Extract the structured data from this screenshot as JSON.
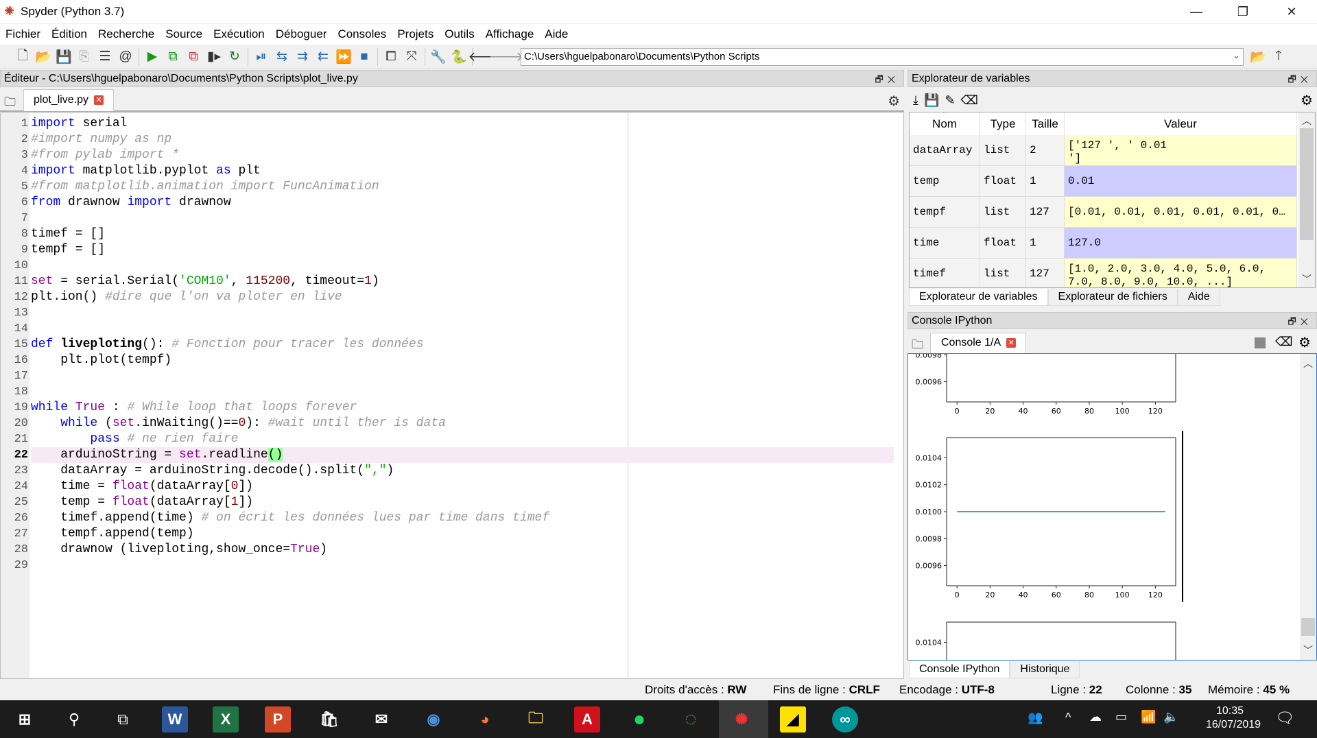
{
  "window": {
    "title": "Spyder (Python 3.7)",
    "controls": [
      "minimize-icon",
      "restore-icon",
      "close-icon"
    ]
  },
  "menu": [
    "Fichier",
    "Édition",
    "Recherche",
    "Source",
    "Exécution",
    "Déboguer",
    "Consoles",
    "Projets",
    "Outils",
    "Affichage",
    "Aide"
  ],
  "toolbar": {
    "path": "C:\\Users\\hguelpabonaro\\Documents\\Python Scripts"
  },
  "editor": {
    "title": "Éditeur - C:\\Users\\hguelpabonaro\\Documents\\Python Scripts\\plot_live.py",
    "tab": "plot_live.py",
    "current_line": 22,
    "lines": [
      [
        [
          "kw",
          "import"
        ],
        [
          "",
          " serial"
        ]
      ],
      [
        [
          "cm",
          "#import numpy as np"
        ]
      ],
      [
        [
          "cm",
          "#from pylab import *"
        ]
      ],
      [
        [
          "kw",
          "import"
        ],
        [
          "",
          " matplotlib.pyplot "
        ],
        [
          "kw",
          "as"
        ],
        [
          "",
          " plt"
        ]
      ],
      [
        [
          "cm",
          "#from matplotlib.animation import FuncAnimation"
        ]
      ],
      [
        [
          "kw",
          "from"
        ],
        [
          "",
          " drawnow "
        ],
        [
          "kw",
          "import"
        ],
        [
          "",
          " drawnow"
        ]
      ],
      [],
      [
        [
          "",
          "timef = []"
        ]
      ],
      [
        [
          "",
          "tempf = []"
        ]
      ],
      [],
      [
        [
          "bi",
          "set"
        ],
        [
          "",
          " = serial.Serial("
        ],
        [
          "st",
          "'COM10'"
        ],
        [
          "",
          ", "
        ],
        [
          "nm",
          "115200"
        ],
        [
          "",
          ", timeout="
        ],
        [
          "nm",
          "1"
        ],
        [
          "",
          ")"
        ]
      ],
      [
        [
          "",
          "plt.ion() "
        ],
        [
          "cm",
          "#dire que l'on va ploter en live"
        ]
      ],
      [],
      [],
      [
        [
          "kw",
          "def"
        ],
        [
          "",
          " "
        ],
        [
          "fn",
          "liveploting"
        ],
        [
          "",
          "(): "
        ],
        [
          "cm",
          "# Fonction pour tracer les données"
        ]
      ],
      [
        [
          "",
          "    plt.plot(tempf)"
        ]
      ],
      [],
      [],
      [
        [
          "kw",
          "while"
        ],
        [
          "",
          " "
        ],
        [
          "bi",
          "True"
        ],
        [
          "",
          " : "
        ],
        [
          "cm",
          "# While loop that loops forever"
        ]
      ],
      [
        [
          "",
          "    "
        ],
        [
          "kw",
          "while"
        ],
        [
          "",
          " ("
        ],
        [
          "bi",
          "set"
        ],
        [
          "",
          ".inWaiting()=="
        ],
        [
          "nm",
          "0"
        ],
        [
          "",
          "): "
        ],
        [
          "cm",
          "#wait until ther is data"
        ]
      ],
      [
        [
          "",
          "        "
        ],
        [
          "kw",
          "pass"
        ],
        [
          "",
          " "
        ],
        [
          "cm",
          "# ne rien faire"
        ]
      ],
      [
        [
          "",
          "    arduinoString = "
        ],
        [
          "bi",
          "set"
        ],
        [
          "",
          ".readline"
        ],
        [
          "mt",
          "()"
        ]
      ],
      [
        [
          "",
          "    dataArray = arduinoString.decode().split("
        ],
        [
          "st",
          "\",\""
        ],
        [
          "",
          ")"
        ]
      ],
      [
        [
          "",
          "    time = "
        ],
        [
          "bi",
          "float"
        ],
        [
          "",
          "(dataArray["
        ],
        [
          "nm",
          "0"
        ],
        [
          "",
          "])"
        ]
      ],
      [
        [
          "",
          "    temp = "
        ],
        [
          "bi",
          "float"
        ],
        [
          "",
          "(dataArray["
        ],
        [
          "nm",
          "1"
        ],
        [
          "",
          "])"
        ]
      ],
      [
        [
          "",
          "    timef.append(time) "
        ],
        [
          "cm",
          "# on écrit les données lues par time dans timef"
        ]
      ],
      [
        [
          "",
          "    tempf.append(temp)"
        ]
      ],
      [
        [
          "",
          "    drawnow (liveploting,show_once="
        ],
        [
          "bi",
          "True"
        ],
        [
          "",
          ")"
        ]
      ],
      []
    ]
  },
  "variable_explorer": {
    "title": "Explorateur de variables",
    "columns": [
      "Nom",
      "Type",
      "Taille",
      "Valeur"
    ],
    "rows": [
      {
        "name": "dataArray",
        "type": "list",
        "size": "2",
        "value": "['127 ', ' 0.01\n']",
        "color": "#ffffcc"
      },
      {
        "name": "temp",
        "type": "float",
        "size": "1",
        "value": "0.01",
        "color": "#ccccff"
      },
      {
        "name": "tempf",
        "type": "list",
        "size": "127",
        "value": "[0.01, 0.01, 0.01, 0.01, 0.01, 0…",
        "color": "#ffffcc"
      },
      {
        "name": "time",
        "type": "float",
        "size": "1",
        "value": "127.0",
        "color": "#ccccff"
      },
      {
        "name": "timef",
        "type": "list",
        "size": "127",
        "value": "[1.0, 2.0, 3.0, 4.0, 5.0, 6.0,\n7.0, 8.0, 9.0, 10.0, ...]",
        "color": "#ffffcc"
      }
    ],
    "tabs": [
      "Explorateur de variables",
      "Explorateur de fichiers",
      "Aide"
    ],
    "active_tab": 0
  },
  "console": {
    "title": "Console IPython",
    "tab": "Console 1/A",
    "tabs": [
      "Console IPython",
      "Historique"
    ],
    "active_tab": 0
  },
  "chart_data": {
    "type": "line",
    "xlim": [
      -6.3,
      132.3
    ],
    "ylim": [
      0.00945,
      0.01055
    ],
    "xticks": [
      "0",
      "20",
      "40",
      "60",
      "80",
      "100",
      "120"
    ],
    "yticks": [
      "0.0096",
      "0.0098",
      "0.0100",
      "0.0102",
      "0.0104"
    ],
    "line_color": "#1f77b4",
    "x_range": [
      0,
      126
    ],
    "y": [
      0.01,
      0.01,
      0.01,
      0.01,
      0.01,
      0.01,
      0.01,
      0.01,
      0.01,
      0.01,
      0.01,
      0.01,
      0.01,
      0.01,
      0.01,
      0.01,
      0.01,
      0.01,
      0.01,
      0.01,
      0.01,
      0.01,
      0.01,
      0.01,
      0.01,
      0.01,
      0.01,
      0.01,
      0.01,
      0.01,
      0.01,
      0.01,
      0.01,
      0.01,
      0.01,
      0.01,
      0.01,
      0.01,
      0.01,
      0.01,
      0.01,
      0.01,
      0.01,
      0.01,
      0.01,
      0.01,
      0.01,
      0.01,
      0.01,
      0.01,
      0.01,
      0.01,
      0.01,
      0.01,
      0.01,
      0.01,
      0.01,
      0.01,
      0.01,
      0.01,
      0.01,
      0.01,
      0.01,
      0.01,
      0.01,
      0.01,
      0.01,
      0.01,
      0.01,
      0.01,
      0.01,
      0.01,
      0.01,
      0.01,
      0.01,
      0.01,
      0.01,
      0.01,
      0.01,
      0.01,
      0.01,
      0.01,
      0.01,
      0.01,
      0.01,
      0.01,
      0.01,
      0.01,
      0.01,
      0.01,
      0.01,
      0.01,
      0.01,
      0.01,
      0.01,
      0.01,
      0.01,
      0.01,
      0.01,
      0.01,
      0.01,
      0.01,
      0.01,
      0.01,
      0.01,
      0.01,
      0.01,
      0.01,
      0.01,
      0.01,
      0.01,
      0.01,
      0.01,
      0.01,
      0.01,
      0.01,
      0.01,
      0.01,
      0.01,
      0.01,
      0.01,
      0.01,
      0.01,
      0.01,
      0.01,
      0.01,
      0.01
    ],
    "grid": false
  },
  "status": {
    "access_label": "Droits d'accès :",
    "access": "RW",
    "eol_label": "Fins de ligne :",
    "eol": "CRLF",
    "enc_label": "Encodage :",
    "enc": "UTF-8",
    "line_label": "Ligne :",
    "line": "22",
    "col_label": "Colonne :",
    "col": "35",
    "mem_label": "Mémoire :",
    "mem": "45 %"
  },
  "taskbar": {
    "apps": [
      "windows-start",
      "search",
      "task-view",
      "word",
      "excel",
      "powerpoint",
      "store",
      "mail",
      "outlook",
      "firefox",
      "file-explorer",
      "acrobat",
      "spotify",
      "app-circle",
      "spyder",
      "sticky-notes",
      "arduino"
    ],
    "active": "spyder",
    "clock": {
      "time": "10:35",
      "date": "16/07/2019"
    }
  }
}
